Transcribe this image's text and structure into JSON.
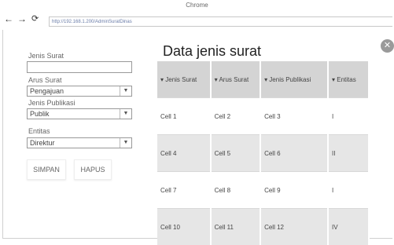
{
  "browser": {
    "title": "Chrome",
    "url": "http://192.168.1.200/AdminSuratDinas"
  },
  "form": {
    "jenis_surat_label": "Jenis Surat",
    "jenis_surat_value": "",
    "arus_surat_label": "Arus Surat",
    "arus_surat_value": "Pengajuan",
    "jenis_publikasi_label": "Jenis Publikasi",
    "jenis_publikasi_value": "Publik",
    "entitas_label": "Entitas",
    "entitas_value": "Direktur",
    "simpan_label": "SIMPAN",
    "hapus_label": "HAPUS"
  },
  "panel": {
    "title": "Data jenis surat"
  },
  "table": {
    "headers": [
      "▾ Jenis Surat",
      "▾ Arus Surat",
      "▾ Jenis Publikasi",
      "▾ Entitas"
    ],
    "rows": [
      [
        "Cell 1",
        "Cell 2",
        "Cell 3",
        "I"
      ],
      [
        "Cell 4",
        "Cell 5",
        "Cell 6",
        "II"
      ],
      [
        "Cell 7",
        "Cell 8",
        "Cell 9",
        "I"
      ],
      [
        "Cell 10",
        "Cell 11",
        "Cell 12",
        "IV"
      ]
    ]
  },
  "icons": {
    "back": "back-arrow-icon",
    "forward": "forward-arrow-icon",
    "reload": "reload-icon",
    "close": "close-icon",
    "dropdown": "chevron-down-icon"
  }
}
